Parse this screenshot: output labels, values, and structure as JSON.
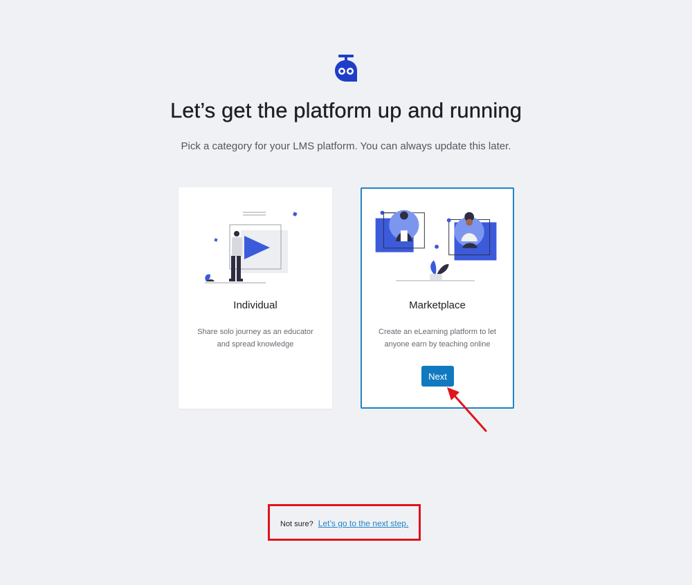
{
  "header": {
    "title": "Let’s get the platform up and running",
    "subtitle": "Pick a category for your LMS platform. You can always update this later."
  },
  "cards": [
    {
      "title": "Individual",
      "description": "Share solo journey as an educator and spread knowledge",
      "selected": false
    },
    {
      "title": "Marketplace",
      "description": "Create an eLearning platform to let anyone earn by teaching online",
      "selected": true,
      "button_label": "Next"
    }
  ],
  "footer": {
    "prefix": "Not sure?",
    "link_label": "Let’s go to the next step."
  },
  "colors": {
    "background": "#f0f1f5",
    "accent": "#1d84c6",
    "button": "#1179bf",
    "illustration": "#3b5bdb",
    "annotation": "#e0141c"
  },
  "icons": {
    "logo": "robot-head-logo-icon",
    "annotation_arrow": "red-arrow-icon"
  }
}
